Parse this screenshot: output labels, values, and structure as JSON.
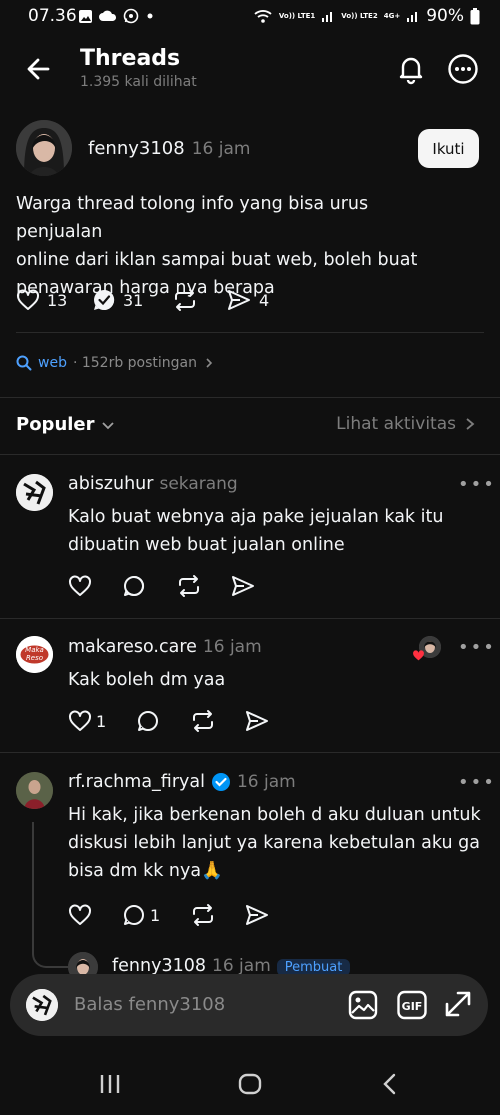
{
  "status": {
    "time": "07.36",
    "battery": "90%",
    "network_1": "Vo)) LTE1",
    "network_2": "Vo)) LTE2",
    "network_type": "4G+"
  },
  "header": {
    "title": "Threads",
    "subtitle": "1.395 kali dilihat",
    "icons": [
      "back-arrow-icon",
      "bell-icon",
      "more-options-icon"
    ]
  },
  "post": {
    "username": "fenny3108",
    "time": "16 jam",
    "follow_label": "Ikuti",
    "text_lines": [
      "Warga thread tolong info yang bisa urus penjualan",
      "online dari iklan sampai buat web, boleh buat",
      "penawaran harga nya berapa"
    ],
    "likes": "13",
    "replies": "31",
    "shares": "4"
  },
  "topic": {
    "tag": "web",
    "count": "· 152rb postingan"
  },
  "sort": {
    "label": "Populer",
    "activity_label": "Lihat aktivitas"
  },
  "comments": [
    {
      "username": "abiszuhur",
      "time": "sekarang",
      "text_lines": [
        "Kalo buat webnya aja pake jejualan kak itu",
        "dibuatin web buat jualan online"
      ],
      "likes": "",
      "replies": ""
    },
    {
      "username": "makareso.care",
      "time": "16 jam",
      "avatar_text": "Maka Reso",
      "text_lines": [
        "Kak boleh dm yaa"
      ],
      "likes": "1",
      "replies": ""
    },
    {
      "username": "rf.rachma_firyal",
      "time": "16 jam",
      "text_lines": [
        "Hi kak, jika berkenan boleh d aku duluan untuk",
        "diskusi lebih lanjut ya karena kebetulan aku ga",
        "bisa dm kk nya🙏"
      ],
      "likes": "",
      "replies": "1"
    }
  ],
  "nested_reply": {
    "username": "fenny3108",
    "time": "16 jam",
    "badge": "Pembuat"
  },
  "reply_bar": {
    "placeholder": "Balas fenny3108"
  },
  "colors": {
    "background": "#101010",
    "accent_blue": "#4ea1ff",
    "verified_blue": "#0095f6",
    "heart_red": "#ff3040"
  }
}
